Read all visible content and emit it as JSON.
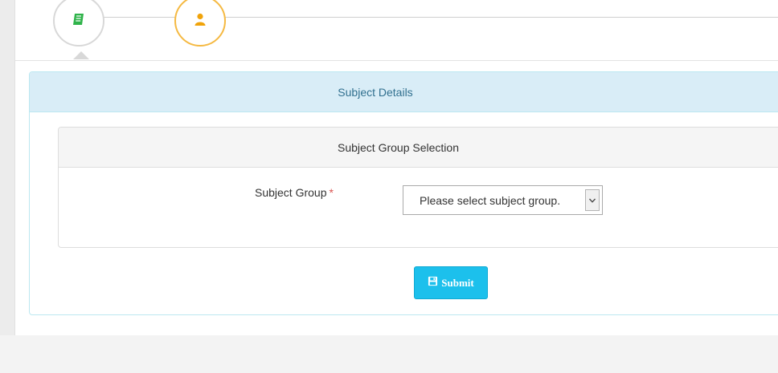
{
  "wizard": {
    "steps": [
      {
        "icon": "book-icon",
        "color": "#2fb34a",
        "state": "active"
      },
      {
        "icon": "user-icon",
        "color": "#f0a30a",
        "state": "pending"
      }
    ]
  },
  "panel": {
    "title": "Subject Details"
  },
  "group_panel": {
    "title": "Subject Group Selection"
  },
  "form": {
    "subject_group_label": "Subject Group",
    "required_marker": "*",
    "subject_group_value": "Please select subject group."
  },
  "actions": {
    "submit_label": "Submit",
    "submit_icon": "save-icon"
  },
  "colors": {
    "panel_heading_bg": "#d9edf7",
    "panel_heading_text": "#31708f",
    "submit_bg": "#1cc0ec",
    "required": "#d9534f"
  }
}
